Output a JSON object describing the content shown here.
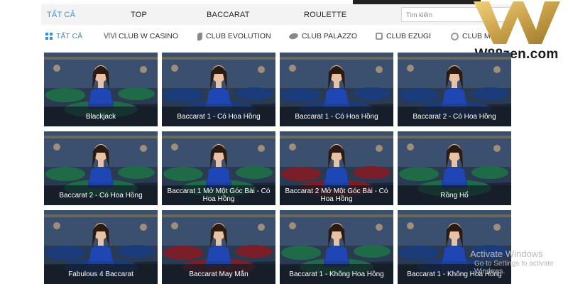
{
  "top_tabs": [
    {
      "label": "TẤT CẢ",
      "active": true
    },
    {
      "label": "TOP",
      "active": false
    },
    {
      "label": "BACCARAT",
      "active": false
    },
    {
      "label": "ROULETTE",
      "active": false
    }
  ],
  "search": {
    "placeholder": "Tìm kiếm"
  },
  "clubs": [
    {
      "label": "TẤT CẢ",
      "icon": "grid-icon",
      "active": true
    },
    {
      "label": "CLUB W CASINO",
      "icon": "w-casino-icon",
      "active": false
    },
    {
      "label": "CLUB EVOLUTION",
      "icon": "evolution-icon",
      "active": false
    },
    {
      "label": "CLUB PALAZZO",
      "icon": "palazzo-icon",
      "active": false
    },
    {
      "label": "CLUB EZUGI",
      "icon": "ezugi-icon",
      "active": false
    },
    {
      "label": "CLUB MG",
      "icon": "mg-icon",
      "active": false
    }
  ],
  "logo": {
    "text": "W88zen.com",
    "colors": {
      "gold": "#c9a14a",
      "dark": "#1a1a1a"
    }
  },
  "games": [
    {
      "name": "Blackjack"
    },
    {
      "name": "Baccarat 1 - Có Hoa Hồng"
    },
    {
      "name": "Baccarat 1 - Có Hoa Hồng"
    },
    {
      "name": "Baccarat 2 - Có Hoa Hồng"
    },
    {
      "name": "Baccarat 2 - Có Hoa Hồng"
    },
    {
      "name": "Baccarat 1 Mở Một Góc Bài - Có Hoa Hồng"
    },
    {
      "name": "Baccarat 2 Mở Một Góc Bài - Có Hoa Hồng"
    },
    {
      "name": "Rồng Hổ"
    },
    {
      "name": "Fabulous 4 Baccarat"
    },
    {
      "name": "Baccarat May Mắn"
    },
    {
      "name": "Baccarat 1 - Không Hoa Hồng"
    },
    {
      "name": "Baccarat 1 - Không Hoa Hồng"
    }
  ],
  "watermark": {
    "line1": "Activate Windows",
    "line2": "Go to Settings to activate Windows."
  },
  "colors": {
    "accent": "#3a8fd6",
    "nav_bg": "#f3f3f3",
    "label_bg": "#141c24"
  }
}
